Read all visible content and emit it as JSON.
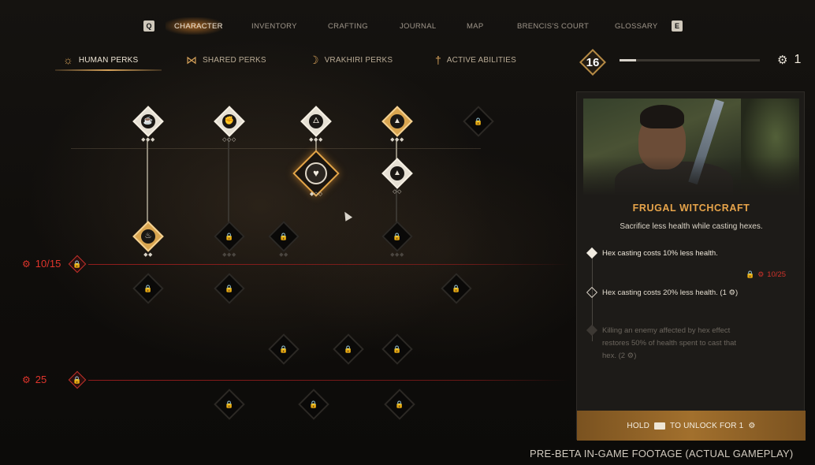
{
  "nav": {
    "left_key": "Q",
    "right_key": "E",
    "items": [
      {
        "label": "CHARACTER",
        "active": true
      },
      {
        "label": "INVENTORY",
        "active": false
      },
      {
        "label": "CRAFTING",
        "active": false
      },
      {
        "label": "JOURNAL",
        "active": false
      },
      {
        "label": "MAP",
        "active": false
      },
      {
        "label": "BRENCIS'S COURT",
        "active": false
      },
      {
        "label": "GLOSSARY",
        "active": false
      }
    ]
  },
  "perk_tabs": [
    {
      "label": "HUMAN PERKS",
      "icon": "sun-icon",
      "active": true
    },
    {
      "label": "SHARED PERKS",
      "icon": "infinity-icon",
      "active": false
    },
    {
      "label": "VRAKHIRI PERKS",
      "icon": "moon-icon",
      "active": false
    },
    {
      "label": "ACTIVE ABILITIES",
      "icon": "dagger-icon",
      "active": false
    }
  ],
  "level": {
    "value": "16",
    "xp_fraction": 0.12
  },
  "perk_points": {
    "icon": "perk-point-icon",
    "value": "1"
  },
  "tiers": [
    {
      "requirement": "10/15",
      "icon": "perk-point-icon",
      "lock_icon": "lock-icon"
    },
    {
      "requirement": "25",
      "icon": "perk-point-icon",
      "lock_icon": "lock-icon"
    }
  ],
  "nodes": {
    "mug": {
      "glyph": "☕",
      "pips": "◆◆◆"
    },
    "fist": {
      "glyph": "✊",
      "pips": "◇◇◇"
    },
    "flame": {
      "glyph": "🜂",
      "pips": "◆◆◆"
    },
    "triangle1": {
      "glyph": "▲",
      "pips": "◆◆◆"
    },
    "heart": {
      "glyph": "♥",
      "pips": "◆◇◇"
    },
    "triangle2": {
      "glyph": "▲",
      "pips": "◇◇"
    },
    "bowl": {
      "glyph": "♨",
      "pips": "◆◆"
    },
    "lock_glyph": "🔒",
    "lock_pips2": "◆◆",
    "lock_pips3": "◆◆◆"
  },
  "panel": {
    "title": "FRUGAL WITCHCRAFT",
    "description": "Sacrifice less health while casting hexes.",
    "ranks": [
      {
        "text": "Hex casting costs 10% less health.",
        "state": "unlocked"
      },
      {
        "text": "Hex casting costs 20% less health.  (1 ⚙)",
        "state": "available"
      },
      {
        "text": "Killing an enemy affected by hex effect restores 50% of health spent to cast that hex.  (2 ⚙)",
        "state": "locked"
      }
    ],
    "rank3_requirement": "10/25",
    "unlock_prompt": {
      "pre": "HOLD",
      "post": "TO UNLOCK FOR 1"
    }
  },
  "footer": "PRE-BETA IN-GAME FOOTAGE (ACTUAL GAMEPLAY)",
  "colors": {
    "accent": "#d6a25a",
    "locked_red": "#e0352c",
    "panel_title": "#e7a44a"
  }
}
